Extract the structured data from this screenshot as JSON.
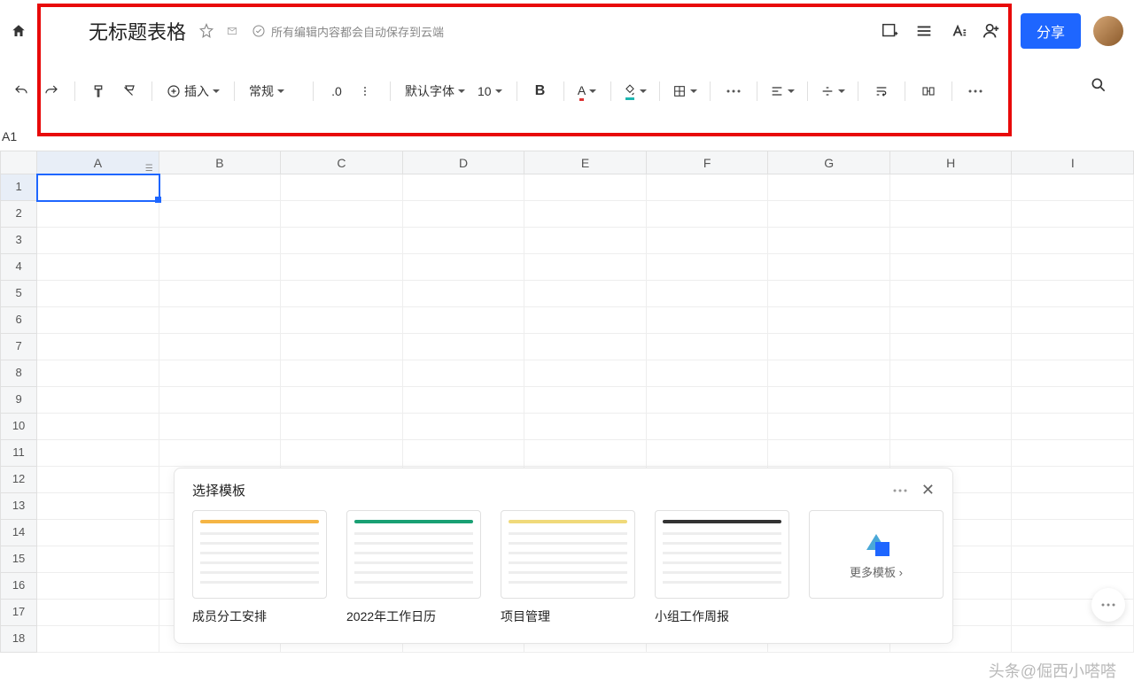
{
  "header": {
    "title": "无标题表格",
    "autosave": "所有编辑内容都会自动保存到云端",
    "share_label": "分享"
  },
  "toolbar": {
    "insert_label": "插入",
    "format_label": "常规",
    "decimal_label": ".0",
    "font_label": "默认字体",
    "font_size": "10",
    "bold_label": "B"
  },
  "namebox": "A1",
  "columns": [
    "A",
    "B",
    "C",
    "D",
    "E",
    "F",
    "G",
    "H",
    "I"
  ],
  "rows": [
    "1",
    "2",
    "3",
    "4",
    "5",
    "6",
    "7",
    "8",
    "9",
    "10",
    "11",
    "12",
    "13",
    "14",
    "15",
    "16",
    "17",
    "18"
  ],
  "active_cell": {
    "col": 0,
    "row": 0
  },
  "templates": {
    "title": "选择模板",
    "items": [
      {
        "label": "成员分工安排",
        "accent": "#f5b544"
      },
      {
        "label": "2022年工作日历",
        "accent": "#1aa074"
      },
      {
        "label": "项目管理",
        "accent": "#f0d97a"
      },
      {
        "label": "小组工作周报",
        "accent": "#333333"
      }
    ],
    "more_label": "更多模板 ›"
  },
  "watermark": "头条@倔西小嗒嗒"
}
